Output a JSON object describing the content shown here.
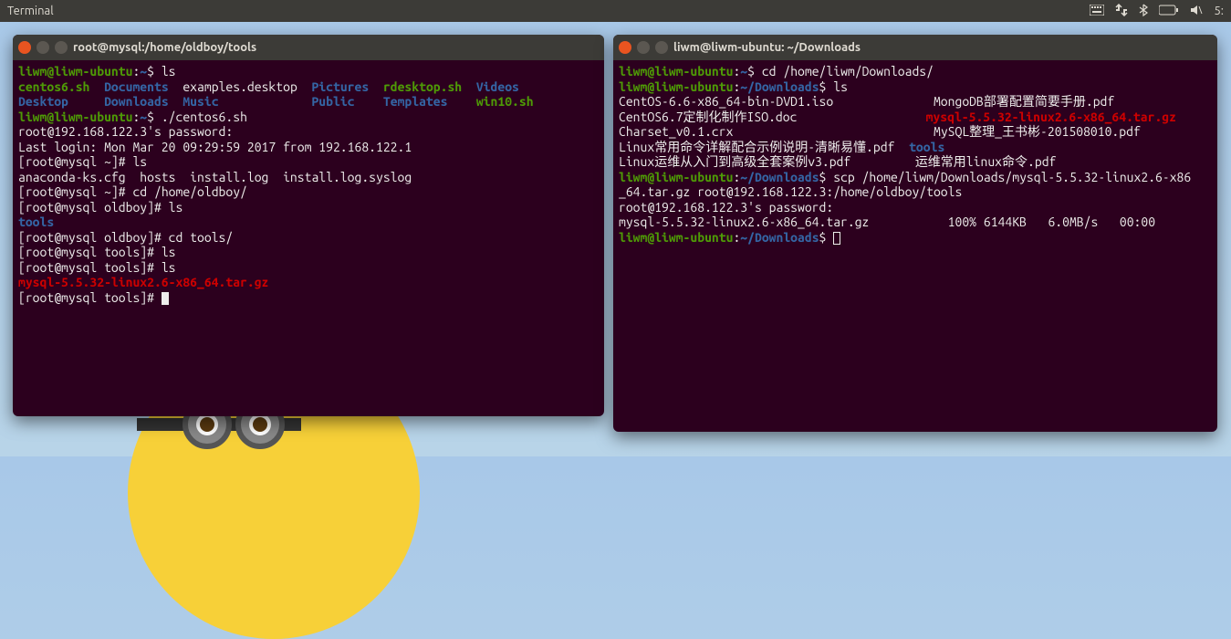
{
  "menubar": {
    "title": "Terminal",
    "time": "5:"
  },
  "left": {
    "title": "root@mysql:/home/oldboy/tools",
    "prompt1_user": "liwm@liwm-ubuntu",
    "prompt1_sep": ":",
    "prompt1_path": "~",
    "prompt1_sym": "$ ",
    "cmd1": "ls",
    "ls_row1": {
      "a": "centos6.sh",
      "b": "Documents",
      "c": "examples.desktop",
      "d": "Pictures",
      "e": "rdesktop.sh",
      "f": "Videos"
    },
    "ls_row2": {
      "a": "Desktop",
      "b": "Downloads",
      "c": "Music",
      "d": "Public",
      "e": "Templates",
      "f": "win10.sh"
    },
    "cmd2": "./centos6.sh",
    "pw_line": "root@192.168.122.3's password:",
    "last_login": "Last login: Mon Mar 20 09:29:59 2017 from 192.168.122.1",
    "pr_root_home": "[root@mysql ~]# ",
    "cmd3": "ls",
    "ls3": "anaconda-ks.cfg  hosts  install.log  install.log.syslog",
    "cmd4": "cd /home/oldboy/",
    "pr_root_oldboy": "[root@mysql oldboy]# ",
    "cmd5": "ls",
    "tools": "tools",
    "cmd6": "cd tools/",
    "pr_root_tools": "[root@mysql tools]# ",
    "cmd7": "ls",
    "cmd8": "ls",
    "tarfile": "mysql-5.5.32-linux2.6-x86_64.tar.gz"
  },
  "right": {
    "title": "liwm@liwm-ubuntu: ~/Downloads",
    "prompt_user": "liwm@liwm-ubuntu",
    "prompt_sep": ":",
    "prompt_path_home": "~",
    "prompt_path_dl": "~/Downloads",
    "prompt_sym": "$ ",
    "cmd1": "cd /home/liwm/Downloads/",
    "cmd2": "ls",
    "ls_col1": {
      "a": "CentOS-6.6-x86_64-bin-DVD1.iso",
      "b": "CentOS6.7定制化制作ISO.doc",
      "c": "Charset_v0.1.crx",
      "d": "Linux常用命令详解配合示例说明-清晰易懂.pdf",
      "e": "Linux运维从入门到高级全套案例v3.pdf"
    },
    "ls_col2": {
      "a": "MongoDB部署配置简要手册.pdf",
      "b": "mysql-5.5.32-linux2.6-x86_64.tar.gz",
      "c": "MySQL整理_王书彬-201508010.pdf",
      "d": "tools",
      "e": "运维常用linux命令.pdf"
    },
    "cmd3": "scp /home/liwm/Downloads/mysql-5.5.32-linux2.6-x86",
    "cmd3b": "_64.tar.gz root@192.168.122.3:/home/oldboy/tools",
    "pw_line": "root@192.168.122.3's password:",
    "scp_file": "mysql-5.5.32-linux2.6-x86_64.tar.gz",
    "scp_pct": "100%",
    "scp_size": "6144KB",
    "scp_speed": "6.0MB/s",
    "scp_time": "00:00"
  }
}
